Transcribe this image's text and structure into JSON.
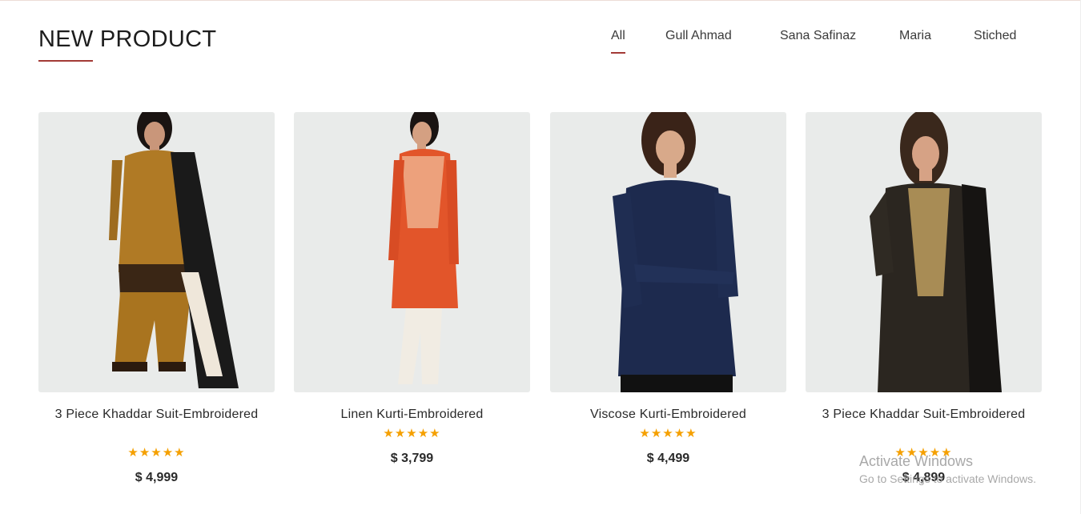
{
  "section": {
    "title": "NEW PRODUCT"
  },
  "filters": [
    "All",
    "Gull Ahmad",
    "Sana Safinaz",
    "Maria",
    "Stiched"
  ],
  "active_filter": "All",
  "products": [
    {
      "name": "3 Piece Khaddar Suit-Embroidered",
      "rating": 5,
      "stars": "★★★★★",
      "price": "$ 4,999"
    },
    {
      "name": "Linen Kurti-Embroidered",
      "rating": 5,
      "stars": "★★★★★",
      "price": "$ 3,799"
    },
    {
      "name": "Viscose Kurti-Embroidered",
      "rating": 5,
      "stars": "★★★★★",
      "price": "$ 4,499"
    },
    {
      "name": "3 Piece Khaddar Suit-Embroidered",
      "rating": 5,
      "stars": "★★★★★",
      "price": "$ 4,899"
    }
  ],
  "watermark": {
    "line1": "Activate Windows",
    "line2": "Go to Settings to activate Windows."
  },
  "colors": {
    "accent": "#a33a36",
    "star": "#f5a000",
    "card_bg": "#e9ebea"
  }
}
